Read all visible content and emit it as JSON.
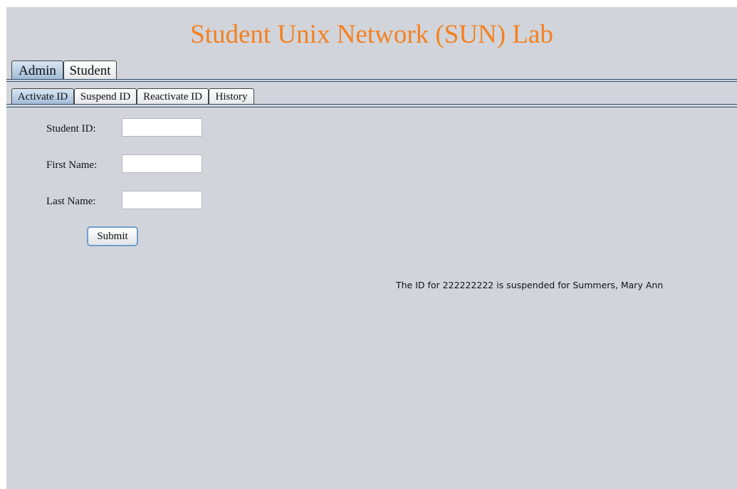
{
  "app": {
    "title": "Student Unix Network (SUN) Lab",
    "title_color": "#f5801f",
    "background_color": "#d1d5db"
  },
  "main_tabs": [
    {
      "label": "Admin",
      "selected": true
    },
    {
      "label": "Student",
      "selected": false
    }
  ],
  "sub_tabs": [
    {
      "label": "Activate ID",
      "selected": true
    },
    {
      "label": "Suspend ID",
      "selected": false
    },
    {
      "label": "Reactivate ID",
      "selected": false
    },
    {
      "label": "History",
      "selected": false
    }
  ],
  "form": {
    "student_id": {
      "label": "Student ID:",
      "value": ""
    },
    "first_name": {
      "label": "First Name:",
      "value": ""
    },
    "last_name": {
      "label": "Last Name:",
      "value": ""
    },
    "submit_label": "Submit"
  },
  "status_message": "The ID for 222222222 is suspended for Summers, Mary Ann"
}
